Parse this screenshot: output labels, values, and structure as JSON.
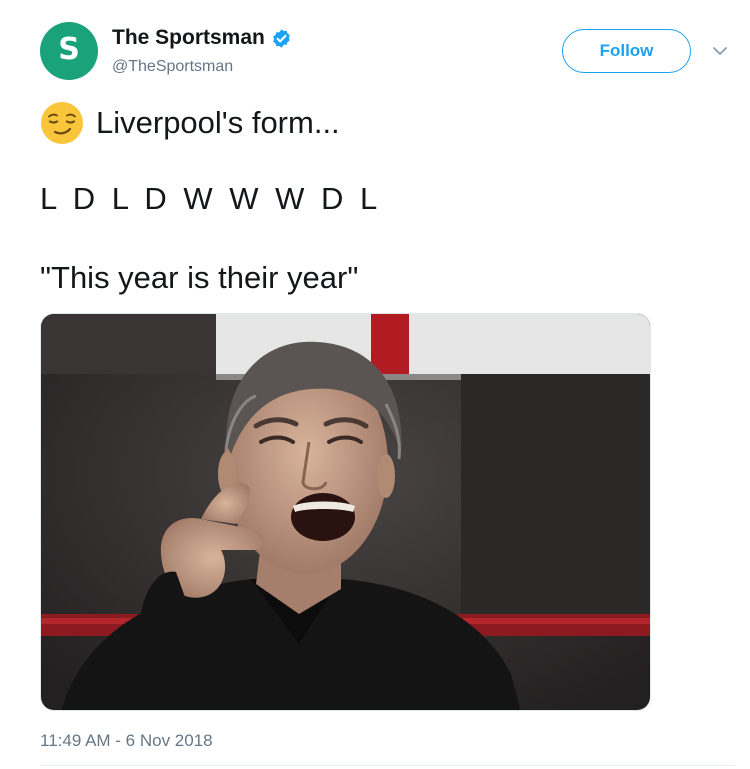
{
  "tweet": {
    "avatar_letter": "S",
    "display_name": "The Sportsman",
    "handle": "@TheSportsman",
    "follow_label": "Follow",
    "text_line1": "Liverpool's form...",
    "text_line2": "L D L D W W W D L",
    "text_line3": "\"This year is their year\"",
    "timestamp": "11:49 AM - 6 Nov 2018"
  },
  "icons": {
    "verified": "verified-badge-icon",
    "caret": "chevron-down-icon",
    "emoji": "smirking-face-emoji"
  },
  "colors": {
    "avatar_bg": "#1aa37a",
    "accent": "#1da1f2",
    "text": "#14171a",
    "muted": "#657786"
  }
}
